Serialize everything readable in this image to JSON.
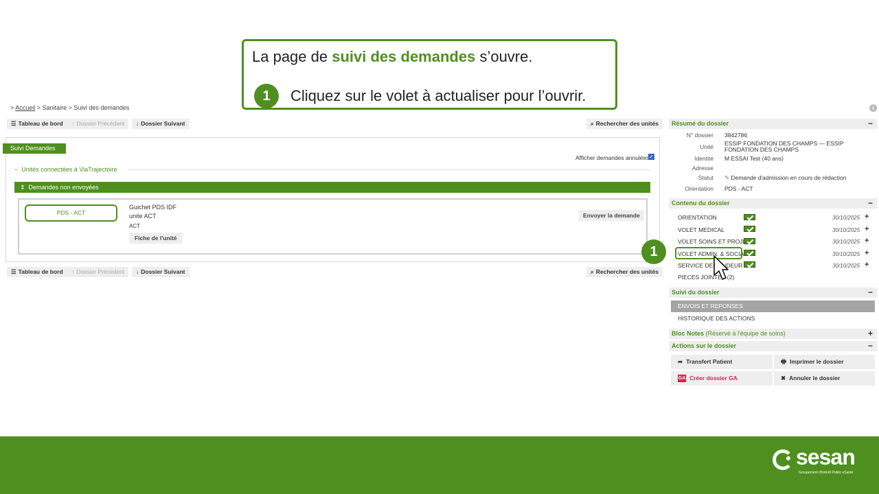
{
  "callout": {
    "line1_prefix": "La page de ",
    "line1_highlight": "suivi des demandes",
    "line1_suffix": " s’ouvre.",
    "step_number": "1",
    "line2": "Cliquez sur le volet à actualiser pour l’ouvrir."
  },
  "breadcrumb": {
    "sep1": "> ",
    "home": "Accueil",
    "sep2": " > ",
    "section": "Sanitaire",
    "sep3": " > ",
    "current": "Suivi des demandes"
  },
  "toolbar": {
    "dashboard": "Tableau de bord",
    "prev": "Dossier Précédent",
    "next": "Dossier Suivant",
    "search_units": "Rechercher des unités"
  },
  "main": {
    "tab_label": "Suivi Demandes",
    "show_cancelled": "Afficher demandes annulées :",
    "connected_units": "Unités connectées à ViaTrajectoire",
    "not_sent_bar": "Demandes non envoyées",
    "card": {
      "unit_tag": "PDS - ACT",
      "line1": "Guichet PDS IDF",
      "line2": "unite ACT",
      "line3": "ACT",
      "fiche_button": "Fiche de l'unité",
      "send_button": "Envoyer la demande"
    }
  },
  "sidebar": {
    "summary": {
      "title": "Résumé du dossier",
      "rows": [
        {
          "label": "N° dossier",
          "value": "3842786"
        },
        {
          "label": "Unité",
          "value": "ESSIP FONDATION DES CHAMPS — ESSIP FONDATION DES CHAMPS"
        },
        {
          "label": "Identité",
          "value": "M ESSAI Test (40 ans)"
        },
        {
          "label": "Adresse",
          "value": ""
        },
        {
          "label": "Statut",
          "value": "Demande d'admission en cours de rédaction"
        },
        {
          "label": "Orientation",
          "value": "PDS - ACT"
        }
      ]
    },
    "content": {
      "title": "Contenu du dossier",
      "items": [
        {
          "label": "ORIENTATION",
          "date": "30/10/2025"
        },
        {
          "label": "VOLET MEDICAL",
          "date": "30/10/2025"
        },
        {
          "label": "VOLET SOINS ET PROJET",
          "date": "30/10/2025"
        },
        {
          "label": "VOLET ADMIN. & SOCIAL",
          "date": "30/10/2025"
        },
        {
          "label": "SERVICE DEMANDEUR",
          "date": "30/10/2025"
        },
        {
          "label": "PIECES JOINTES (2)",
          "date": ""
        }
      ],
      "step_number": "1"
    },
    "followup": {
      "title": "Suivi du dossier",
      "envois": "ENVOIS ET REPONSES",
      "history": "HISTORIQUE DES ACTIONS"
    },
    "notes": {
      "title": "Bloc Notes",
      "subtitle": " (Réservé à l'équipe de soins)"
    },
    "actions": {
      "title": "Actions sur le dossier",
      "transfer": "Transfert Patient",
      "print": "Imprimer le dossier",
      "create_ga": "Créer dossier GA",
      "ga_badge": "GA",
      "cancel": "Annuler le dossier"
    }
  },
  "footer": {
    "logo_word": "sesan",
    "logo_sub": "Groupement d'Intérêt Public eSanté"
  },
  "colors": {
    "brand_green": "#4f8f1f",
    "ga_red": "#d9204b"
  }
}
